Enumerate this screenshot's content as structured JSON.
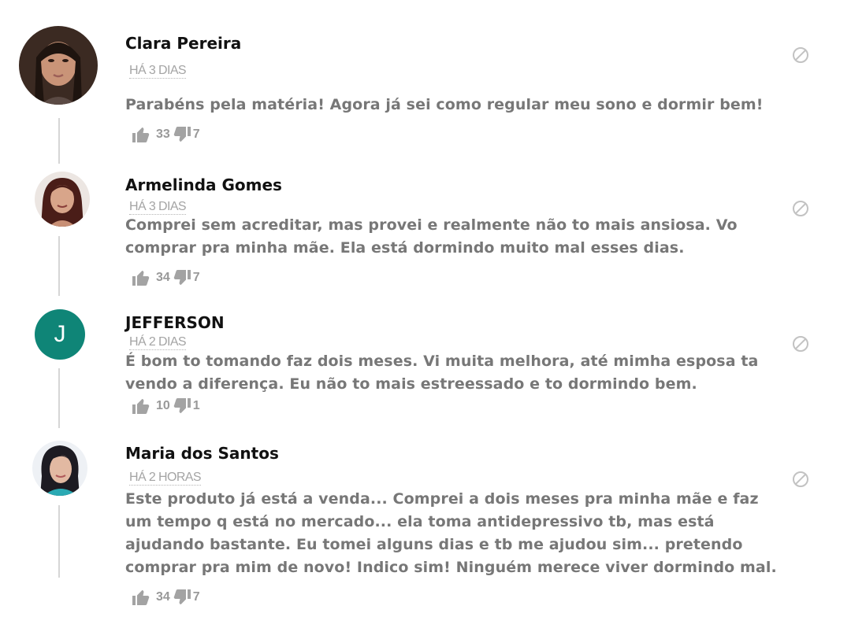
{
  "comments": [
    {
      "author": "Clara Pereira",
      "time": "HÁ 3 DIAS",
      "text": "Parabéns pela matéria! Agora já sei como regular meu sono e dormir bem!",
      "likes": "33",
      "dislikes": "7",
      "avatar_type": "photo",
      "avatar_colors": [
        "#3b2a22",
        "#c99478"
      ]
    },
    {
      "author": "Armelinda Gomes",
      "time": "HÁ 3 DIAS",
      "text": "Comprei sem acreditar, mas provei e realmente não to mais ansiosa. Vo comprar pra minha mãe. Ela está dormindo muito mal esses dias.",
      "likes": "34",
      "dislikes": "7",
      "avatar_type": "photo",
      "avatar_colors": [
        "#4a1d18",
        "#d8a58a"
      ]
    },
    {
      "author": "JEFFERSON",
      "time": "HÁ 2 DIAS",
      "text": "É bom to tomando faz dois meses. Vi muita melhora, até mimha esposa ta vendo a diferença. Eu não to mais estreessado e to dormindo bem.",
      "likes": "10",
      "dislikes": "1",
      "avatar_type": "initial",
      "avatar_initial": "J",
      "avatar_colors": [
        "#0f8577",
        "#ffffff"
      ]
    },
    {
      "author": "Maria dos Santos",
      "time": "HÁ 2 HORAS",
      "text": "Este produto já está a venda... Comprei a dois meses pra minha mãe e faz um tempo q está no mercado... ela toma antidepressivo tb, mas está ajudando bastante. Eu tomei alguns dias e tb me ajudou sim... pretendo comprar pra mim de novo! Indico sim! Ninguém merece viver dormindo mal.",
      "likes": "34",
      "dislikes": "7",
      "avatar_type": "photo",
      "avatar_colors": [
        "#1d1b22",
        "#e2b9a2"
      ]
    }
  ],
  "icons": {
    "like": "thumbs-up-icon",
    "dislike": "thumbs-down-icon",
    "flag": "prohibited-icon"
  },
  "colors": {
    "text": "#777777",
    "author": "#111111",
    "meta": "#a4a4a4",
    "thread_line": "#d6d6d6",
    "initial_avatar": "#0f8577"
  }
}
